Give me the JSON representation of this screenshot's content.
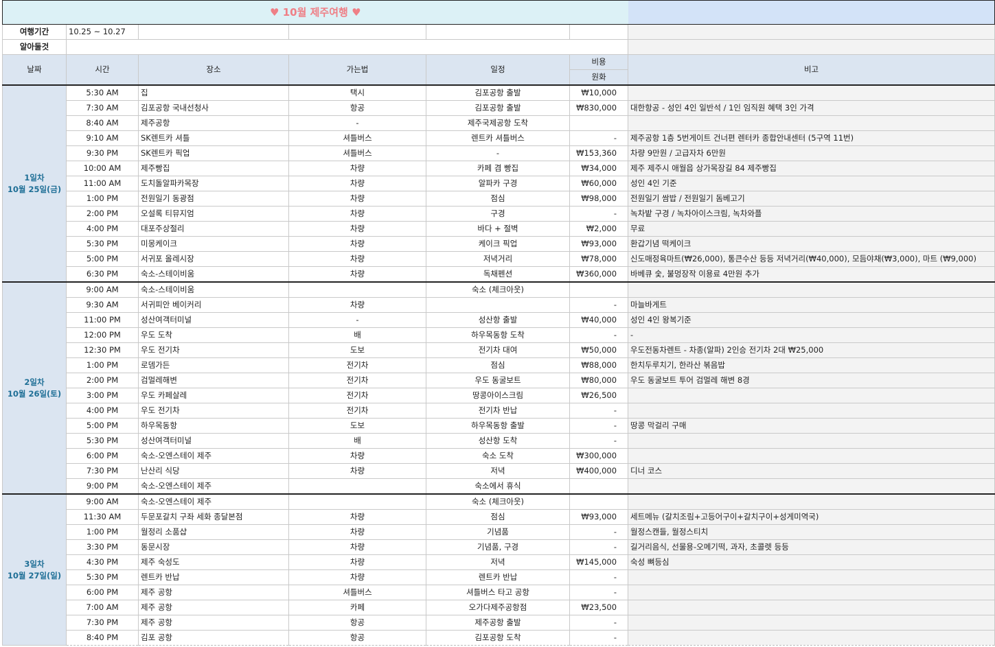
{
  "title": "10월 제주여행",
  "heart_icon": "heart-icon",
  "info": {
    "period_label": "여행기간",
    "period_value": "10.25 ~ 10.27",
    "notes_label": "알아둘것",
    "notes_value": ""
  },
  "headers": {
    "date": "날짜",
    "time": "시간",
    "place": "장소",
    "transport": "가는법",
    "schedule": "일정",
    "cost": "비용",
    "currency": "원화",
    "remarks": "비고"
  },
  "days": [
    {
      "label": "1일차",
      "date": "10월 25일(금)",
      "rows": [
        {
          "time": "5:30 AM",
          "place": "집",
          "transport": "택시",
          "schedule": "김포공항 출발",
          "cost": "₩10,000",
          "remark": ""
        },
        {
          "time": "7:30 AM",
          "place": "김포공항 국내선청사",
          "transport": "항공",
          "schedule": "김포공항 출발",
          "cost": "₩830,000",
          "remark": "대한항공 - 성인 4인 일반석 / 1인 임직원 혜택 3인 가격"
        },
        {
          "time": "8:40 AM",
          "place": "제주공항",
          "transport": "-",
          "schedule": "제주국제공항 도착",
          "cost": "",
          "remark": ""
        },
        {
          "time": "9:10 AM",
          "place": "SK렌트카 셔틀",
          "transport": "셔틀버스",
          "schedule": "렌트카 셔틀버스",
          "cost": "-",
          "remark": "제주공항 1층 5번게이트 건너편 렌터카 종합안내센터 (5구역 11번)"
        },
        {
          "time": "9:30 PM",
          "place": "SK렌트카 픽업",
          "transport": "셔틀버스",
          "schedule": "-",
          "cost": "₩153,360",
          "remark": "차량 9만원 / 고급자차 6만원"
        },
        {
          "time": "10:00 AM",
          "place": "제주빵집",
          "transport": "차량",
          "schedule": "카페 겸 빵집",
          "cost": "₩34,000",
          "remark": "제주 제주시 애월읍 상가목장길 84 제주빵집"
        },
        {
          "time": "11:00 AM",
          "place": "도치돌알파카목장",
          "transport": "차량",
          "schedule": "알파카 구경",
          "cost": "₩60,000",
          "remark": "성인 4인 기준"
        },
        {
          "time": "1:00 PM",
          "place": "전원일기 동광점",
          "transport": "차량",
          "schedule": "점심",
          "cost": "₩98,000",
          "remark": "전원일기 쌈밥 / 전원일기 돔베고기"
        },
        {
          "time": "2:00 PM",
          "place": "오설록 티뮤지엄",
          "transport": "차량",
          "schedule": "구경",
          "cost": "-",
          "remark": "녹차밭 구경 / 녹차아이스크림, 녹차와플"
        },
        {
          "time": "4:00 PM",
          "place": "대포주상절리",
          "transport": "차량",
          "schedule": "바다 + 절벽",
          "cost": "₩2,000",
          "remark": "무료"
        },
        {
          "time": "5:30 PM",
          "place": "미몽케이크",
          "transport": "차량",
          "schedule": "케이크 픽업",
          "cost": "₩93,000",
          "remark": "환갑기념 떡케이크"
        },
        {
          "time": "5:00 PM",
          "place": "서귀포 올레시장",
          "transport": "차량",
          "schedule": "저녁거리",
          "cost": "₩78,000",
          "remark": "신도매정육마트(₩26,000), 통큰수산 등등 저녁거리(₩40,000), 모듬야채(₩3,000), 마트 (₩9,000)"
        },
        {
          "time": "6:30 PM",
          "place": "숙소-스테이비움",
          "transport": "차량",
          "schedule": "독채펜션",
          "cost": "₩360,000",
          "remark": "바베큐 숯, 불멍장작 이용료 4만원 추가"
        }
      ]
    },
    {
      "label": "2일차",
      "date": "10월 26일(토)",
      "rows": [
        {
          "time": "9:00 AM",
          "place": "숙소-스테이비움",
          "transport": "",
          "schedule": "숙소 (체크아웃)",
          "cost": "",
          "remark": ""
        },
        {
          "time": "9:30 AM",
          "place": "서귀피안 베이커리",
          "transport": "차량",
          "schedule": "",
          "cost": "-",
          "remark": "마늘바게트"
        },
        {
          "time": "11:00 PM",
          "place": "성산여객터미널",
          "transport": "-",
          "schedule": "성산항 출발",
          "cost": "₩40,000",
          "remark": "성인 4인 왕복기준"
        },
        {
          "time": "12:00 PM",
          "place": "우도 도착",
          "transport": "배",
          "schedule": "하우목동항 도착",
          "cost": "-",
          "remark": "-"
        },
        {
          "time": "12:30 PM",
          "place": "우도 전기차",
          "transport": "도보",
          "schedule": "전기차 대여",
          "cost": "₩50,000",
          "remark": "우도전동차렌트 - 차종(알파) 2인승 전기차 2대 ₩25,000"
        },
        {
          "time": "1:00 PM",
          "place": "로뎀가든",
          "transport": "전기차",
          "schedule": "점심",
          "cost": "₩88,000",
          "remark": "한치두루치기, 한라산 볶음밥"
        },
        {
          "time": "2:00 PM",
          "place": "검멀레해변",
          "transport": "전기차",
          "schedule": "우도 동굴보트",
          "cost": "₩80,000",
          "remark": "우도 동굴보트 투어 검멀레 해변 8경"
        },
        {
          "time": "3:00 PM",
          "place": "우도 카페살레",
          "transport": "전기차",
          "schedule": "땅콩아이스크림",
          "cost": "₩26,500",
          "remark": ""
        },
        {
          "time": "4:00 PM",
          "place": "우도 전기차",
          "transport": "전기차",
          "schedule": "전기차 반납",
          "cost": "-",
          "remark": ""
        },
        {
          "time": "5:00 PM",
          "place": "하우목동항",
          "transport": "도보",
          "schedule": "하우목동항 출발",
          "cost": "-",
          "remark": "땅콩 막걸리 구매"
        },
        {
          "time": "5:30 PM",
          "place": "성산여객터미널",
          "transport": "배",
          "schedule": "성산항 도착",
          "cost": "-",
          "remark": ""
        },
        {
          "time": "6:00 PM",
          "place": "숙소-오엔스테이 제주",
          "transport": "차량",
          "schedule": "숙소 도착",
          "cost": "₩300,000",
          "remark": ""
        },
        {
          "time": "7:30 PM",
          "place": "난산리 식당",
          "transport": "차량",
          "schedule": "저녁",
          "cost": "₩400,000",
          "remark": "디너 코스"
        },
        {
          "time": "9:00 PM",
          "place": "숙소-오엔스테이 제주",
          "transport": "",
          "schedule": "숙소에서 휴식",
          "cost": "",
          "remark": ""
        }
      ]
    },
    {
      "label": "3일차",
      "date": "10월 27일(일)",
      "rows": [
        {
          "time": "9:00 AM",
          "place": "숙소-오엔스테이 제주",
          "transport": "",
          "schedule": "숙소 (체크아웃)",
          "cost": "",
          "remark": ""
        },
        {
          "time": "11:30 AM",
          "place": "두문포갈치 구좌 세화 종달본점",
          "transport": "차량",
          "schedule": "점심",
          "cost": "₩93,000",
          "remark": "세트메뉴 (갈치조림+고등어구이+갈치구이+성게미역국)"
        },
        {
          "time": "1:00 PM",
          "place": "월정리 소품샵",
          "transport": "차량",
          "schedule": "기념품",
          "cost": "-",
          "remark": "월정스캔들, 월정스티치"
        },
        {
          "time": "3:30 PM",
          "place": "동문시장",
          "transport": "차량",
          "schedule": "기념품, 구경",
          "cost": "-",
          "remark": "길거리음식, 선물용-오메기떡, 과자, 초콜렛 등등"
        },
        {
          "time": "4:30 PM",
          "place": "제주 숙성도",
          "transport": "차량",
          "schedule": "저녁",
          "cost": "₩145,000",
          "remark": "숙성 뼈등심"
        },
        {
          "time": "5:30 PM",
          "place": "렌트카 반납",
          "transport": "차량",
          "schedule": "렌트카 반납",
          "cost": "-",
          "remark": ""
        },
        {
          "time": "6:00 PM",
          "place": "제주 공항",
          "transport": "셔틀버스",
          "schedule": "셔틀버스 타고 공항",
          "cost": "-",
          "remark": ""
        },
        {
          "time": "7:00 AM",
          "place": "제주 공항",
          "transport": "카페",
          "schedule": "오가다제주공항점",
          "cost": "₩23,500",
          "remark": ""
        },
        {
          "time": "7:30 PM",
          "place": "제주 공항",
          "transport": "항공",
          "schedule": "제주공항 출발",
          "cost": "-",
          "remark": ""
        },
        {
          "time": "8:40 PM",
          "place": "김포 공항",
          "transport": "항공",
          "schedule": "김포공항 도착",
          "cost": "-",
          "remark": ""
        }
      ]
    }
  ]
}
